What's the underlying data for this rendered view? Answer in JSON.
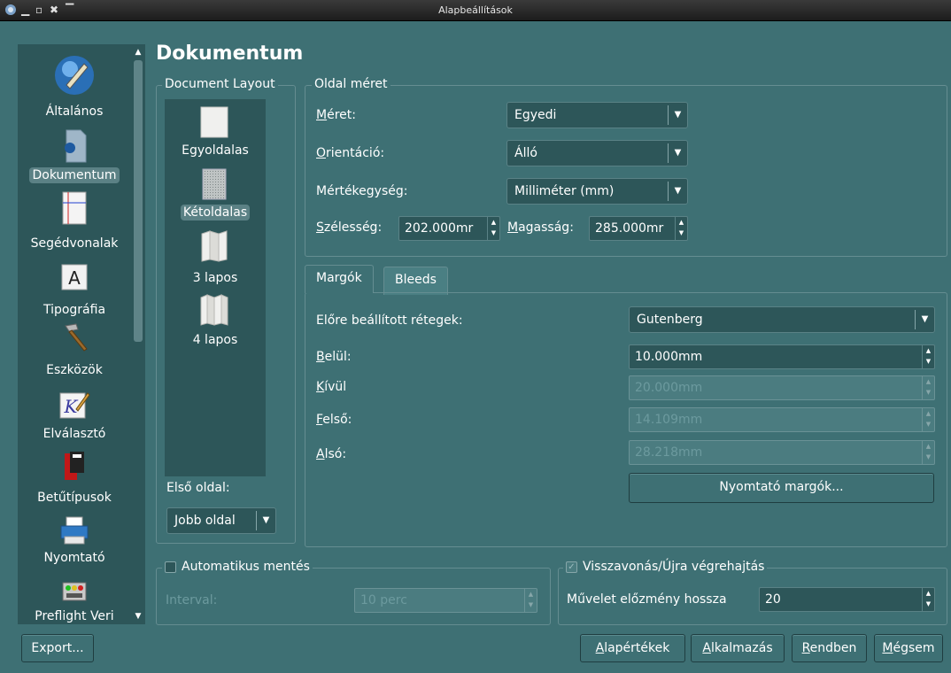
{
  "window": {
    "title": "Alapbeállítások"
  },
  "sidebar": {
    "items": [
      {
        "label": "Általános",
        "icon": "general-icon"
      },
      {
        "label": "Dokumentum",
        "icon": "document-icon"
      },
      {
        "label": "Segédvonalak",
        "icon": "guides-icon"
      },
      {
        "label": "Tipográfia",
        "icon": "typography-icon"
      },
      {
        "label": "Eszközök",
        "icon": "tools-icon"
      },
      {
        "label": "Elválasztó",
        "icon": "hyphenator-icon"
      },
      {
        "label": "Betűtípusok",
        "icon": "fonts-icon"
      },
      {
        "label": "Nyomtató",
        "icon": "printer-icon"
      },
      {
        "label": "Preflight Veri",
        "icon": "preflight-icon"
      }
    ]
  },
  "page_title": "Dokumentum",
  "document_layout": {
    "legend": "Document Layout",
    "items": [
      {
        "label": "Egyoldalas",
        "icon": "single-page-icon"
      },
      {
        "label": "Kétoldalas",
        "icon": "double-sided-icon"
      },
      {
        "label": "3 lapos",
        "icon": "three-fold-icon"
      },
      {
        "label": "4 lapos",
        "icon": "four-fold-icon"
      }
    ],
    "first_page_label": "Első oldal:",
    "first_page_value": "Jobb oldal"
  },
  "page_size": {
    "legend": "Oldal méret",
    "size_label_u": "M",
    "size_label_rest": "éret:",
    "size_value": "Egyedi",
    "orientation_label_u": "O",
    "orientation_label_rest": "rientáció:",
    "orientation_value": "Álló",
    "unit_label": "Mértékegység:",
    "unit_value": "Milliméter (mm)",
    "width_label_u": "S",
    "width_label_rest": "zélesség:",
    "width_value": "202.000mr",
    "height_label_u": "M",
    "height_label_rest": "agasság:",
    "height_value": "285.000mr"
  },
  "tabs": [
    {
      "label": "Margók",
      "active": true
    },
    {
      "label": "Bleeds",
      "active": false
    }
  ],
  "margins": {
    "preset_label": "Előre beállított rétegek:",
    "preset_value": "Gutenberg",
    "inside_label_u": "B",
    "inside_label_rest": "elül:",
    "inside_value": "10.000mm",
    "outside_label_u": "K",
    "outside_label_rest": "ívül",
    "outside_value": "20.000mm",
    "top_label_u": "F",
    "top_label_rest": "első:",
    "top_value": "14.109mm",
    "bottom_label_u": "A",
    "bottom_label_rest": "lsó:",
    "bottom_value": "28.218mm",
    "printer_margins_button": "Nyomtató margók..."
  },
  "autosave": {
    "label": "Automatikus mentés",
    "checked": false,
    "interval_label": "Interval:",
    "interval_value": "10 perc"
  },
  "undo": {
    "label": "Visszavonás/Újra végrehajtás",
    "checked": true,
    "history_label": "Művelet előzmény hossza",
    "history_value": "20"
  },
  "buttons": {
    "export": "Export...",
    "defaults_u": "A",
    "defaults_rest": "lapértékek",
    "apply_u": "A",
    "apply_rest": "lkalmazás",
    "ok_u": "R",
    "ok_rest": "endben",
    "cancel_u": "M",
    "cancel_rest": "égsem"
  }
}
